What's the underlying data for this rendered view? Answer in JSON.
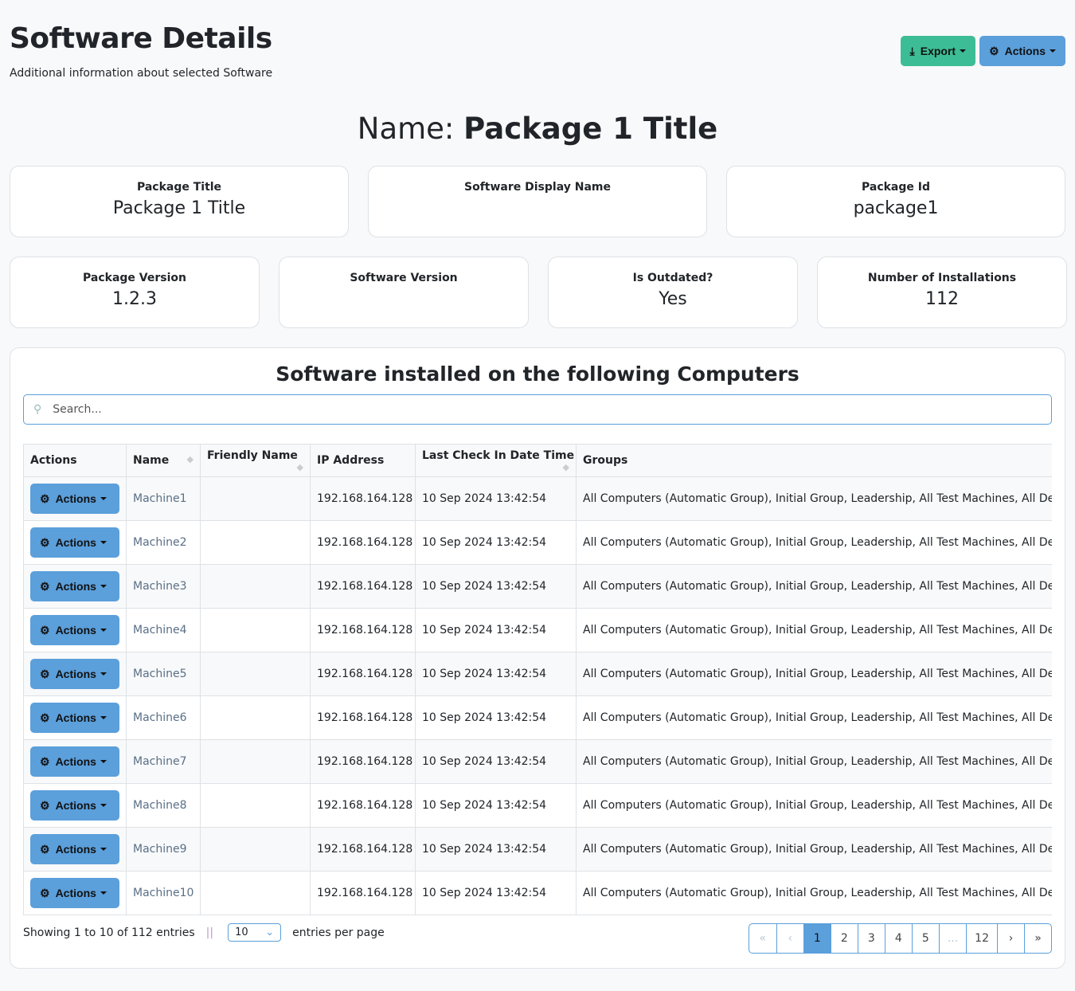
{
  "header": {
    "title": "Software Details",
    "subtitle": "Additional information about selected Software",
    "export_label": "Export",
    "actions_label": "Actions"
  },
  "name": {
    "prefix": "Name:",
    "value": "Package 1 Title"
  },
  "cards_row1": [
    {
      "label": "Package Title",
      "value": "Package 1 Title"
    },
    {
      "label": "Software Display Name",
      "value": ""
    },
    {
      "label": "Package Id",
      "value": "package1"
    }
  ],
  "cards_row2": [
    {
      "label": "Package Version",
      "value": "1.2.3"
    },
    {
      "label": "Software Version",
      "value": ""
    },
    {
      "label": "Is Outdated?",
      "value": "Yes"
    },
    {
      "label": "Number of Installations",
      "value": "112"
    }
  ],
  "table": {
    "title": "Software installed on the following Computers",
    "search_placeholder": "Search...",
    "columns": [
      "Actions",
      "Name",
      "Friendly Name",
      "IP Address",
      "Last Check In Date Time",
      "Groups"
    ],
    "action_label": "Actions",
    "rows": [
      {
        "name": "Machine1",
        "friendly": "",
        "ip": "192.168.164.128",
        "last": "10 Sep 2024 13:42:54",
        "groups": "All Computers (Automatic Group), Initial Group, Leadership, All Test Machines, All Depar"
      },
      {
        "name": "Machine2",
        "friendly": "",
        "ip": "192.168.164.128",
        "last": "10 Sep 2024 13:42:54",
        "groups": "All Computers (Automatic Group), Initial Group, Leadership, All Test Machines, All Depar"
      },
      {
        "name": "Machine3",
        "friendly": "",
        "ip": "192.168.164.128",
        "last": "10 Sep 2024 13:42:54",
        "groups": "All Computers (Automatic Group), Initial Group, Leadership, All Test Machines, All Depar"
      },
      {
        "name": "Machine4",
        "friendly": "",
        "ip": "192.168.164.128",
        "last": "10 Sep 2024 13:42:54",
        "groups": "All Computers (Automatic Group), Initial Group, Leadership, All Test Machines, All Depar"
      },
      {
        "name": "Machine5",
        "friendly": "",
        "ip": "192.168.164.128",
        "last": "10 Sep 2024 13:42:54",
        "groups": "All Computers (Automatic Group), Initial Group, Leadership, All Test Machines, All Depar"
      },
      {
        "name": "Machine6",
        "friendly": "",
        "ip": "192.168.164.128",
        "last": "10 Sep 2024 13:42:54",
        "groups": "All Computers (Automatic Group), Initial Group, Leadership, All Test Machines, All Depar"
      },
      {
        "name": "Machine7",
        "friendly": "",
        "ip": "192.168.164.128",
        "last": "10 Sep 2024 13:42:54",
        "groups": "All Computers (Automatic Group), Initial Group, Leadership, All Test Machines, All Depar"
      },
      {
        "name": "Machine8",
        "friendly": "",
        "ip": "192.168.164.128",
        "last": "10 Sep 2024 13:42:54",
        "groups": "All Computers (Automatic Group), Initial Group, Leadership, All Test Machines, All Depar"
      },
      {
        "name": "Machine9",
        "friendly": "",
        "ip": "192.168.164.128",
        "last": "10 Sep 2024 13:42:54",
        "groups": "All Computers (Automatic Group), Initial Group, Leadership, All Test Machines, All Depar"
      },
      {
        "name": "Machine10",
        "friendly": "",
        "ip": "192.168.164.128",
        "last": "10 Sep 2024 13:42:54",
        "groups": "All Computers (Automatic Group), Initial Group, Leadership, All Test Machines, All Depar"
      }
    ]
  },
  "footer": {
    "showing": "Showing 1 to 10 of 112 entries",
    "separator": "||",
    "per_page": "10",
    "per_page_label": "entries per page",
    "pages": [
      "«",
      "‹",
      "1",
      "2",
      "3",
      "4",
      "5",
      "...",
      "12",
      "›",
      "»"
    ],
    "current_page": "1"
  },
  "colors": {
    "export": "#3dbd95",
    "actions": "#5b9fdb"
  }
}
